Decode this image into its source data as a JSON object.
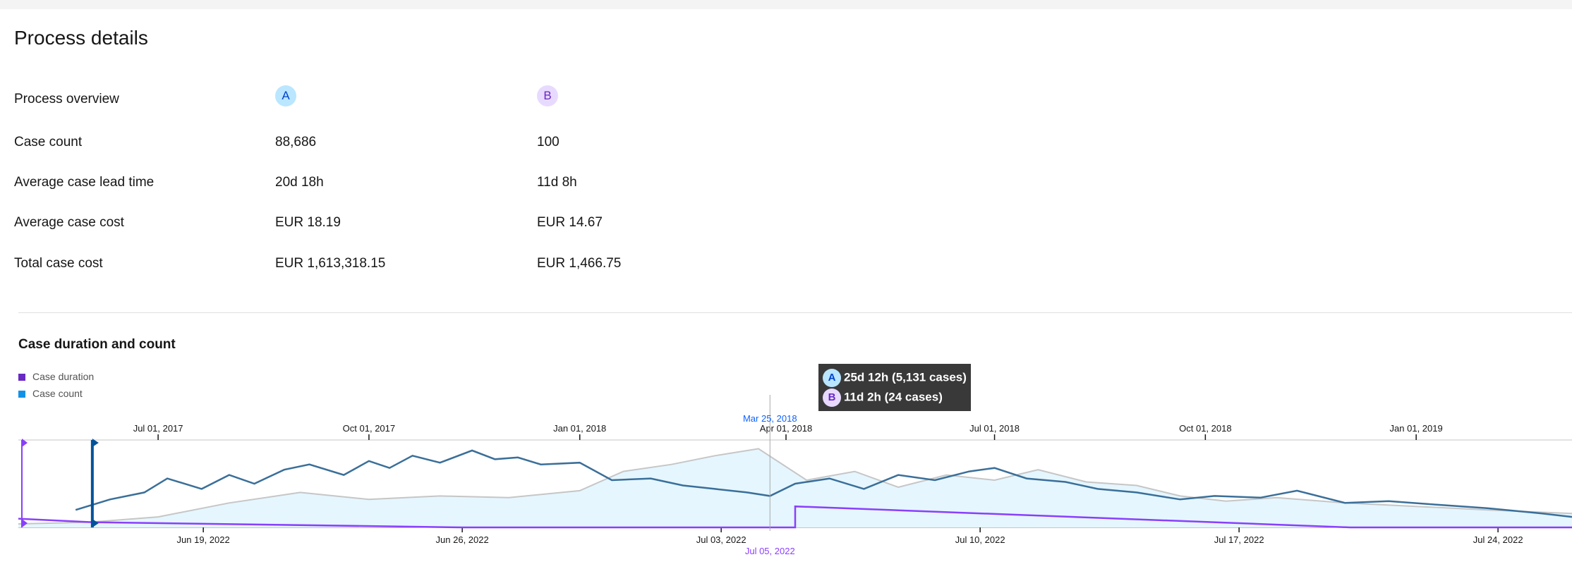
{
  "page_title": "Process details",
  "details": {
    "rows": [
      {
        "label": "Process overview",
        "a": "",
        "b": ""
      },
      {
        "label": "Case count",
        "a": "88,686",
        "b": "100"
      },
      {
        "label": "Average case lead time",
        "a": "20d 18h",
        "b": "11d 8h"
      },
      {
        "label": "Average case cost",
        "a": "EUR 18.19",
        "b": "EUR 14.67"
      },
      {
        "label": "Total case cost",
        "a": "EUR 1,613,318.15",
        "b": "EUR 1,466.75"
      }
    ],
    "badge_a": "A",
    "badge_b": "B"
  },
  "colors": {
    "badge_a_bg": "#bae6ff",
    "badge_b_bg": "#e8daff",
    "series_a_line": "#3a6f99",
    "series_a_fill": "#e5f6ff",
    "series_b_line": "#8a3ffc",
    "case_duration": "#6929c4",
    "case_count": "#1192e8",
    "tooltip_bg": "#393939"
  },
  "tooltip": {
    "a_badge": "A",
    "a_text": "25d 12h (5,131 cases)",
    "b_badge": "B",
    "b_text": "11d 2h (24 cases)"
  },
  "chart_data": {
    "type": "line",
    "title": "Case duration and count",
    "legend": [
      "Case duration",
      "Case count"
    ],
    "legend_position": "top-left",
    "cursor": {
      "top_label": "Mar 25, 2018",
      "bottom_label": "Jul 05, 2022"
    },
    "top_axis": {
      "ticks": [
        "Jul 01, 2017",
        "Oct 01, 2017",
        "Jan 01, 2018",
        "Apr 01, 2018",
        "Jul 01, 2018",
        "Oct 01, 2018",
        "Jan 01, 2019"
      ],
      "range": [
        "May 01, 2017",
        "Mar 10, 2019"
      ]
    },
    "bottom_axis": {
      "ticks": [
        "Jun 19, 2022",
        "Jun 26, 2022",
        "Jul 03, 2022",
        "Jul 10, 2022",
        "Jul 17, 2022",
        "Jul 24, 2022"
      ],
      "range": [
        "Jun 14, 2022",
        "Jul 26, 2022"
      ]
    },
    "series": [
      {
        "name": "A",
        "axis": "top",
        "dates": [
          "2017-05-26",
          "2017-06-10",
          "2017-06-25",
          "2017-07-05",
          "2017-07-20",
          "2017-08-01",
          "2017-08-12",
          "2017-08-25",
          "2017-09-05",
          "2017-09-20",
          "2017-10-01",
          "2017-10-10",
          "2017-10-20",
          "2017-11-01",
          "2017-11-15",
          "2017-11-25",
          "2017-12-05",
          "2017-12-15",
          "2018-01-01",
          "2018-01-15",
          "2018-02-01",
          "2018-02-15",
          "2018-03-01",
          "2018-03-15",
          "2018-03-25",
          "2018-04-05",
          "2018-04-20",
          "2018-05-05",
          "2018-05-20",
          "2018-06-05",
          "2018-06-20",
          "2018-07-01",
          "2018-07-15",
          "2018-08-01",
          "2018-08-15",
          "2018-09-01",
          "2018-09-20",
          "2018-10-05",
          "2018-10-25",
          "2018-11-10",
          "2018-12-01",
          "2018-12-20",
          "2019-01-10",
          "2019-02-01",
          "2019-02-25",
          "2019-03-10"
        ],
        "values": [
          10,
          16,
          20,
          28,
          22,
          30,
          25,
          33,
          36,
          30,
          38,
          34,
          41,
          37,
          44,
          39,
          40,
          36,
          37,
          27,
          28,
          24,
          22,
          20,
          18,
          25,
          28,
          22,
          30,
          27,
          32,
          34,
          28,
          26,
          22,
          20,
          16,
          18,
          17,
          21,
          14,
          15,
          13,
          11,
          8,
          6
        ]
      },
      {
        "name": "B",
        "axis": "top",
        "dates": [
          "2017-05-01",
          "2017-06-01",
          "2017-07-01",
          "2017-08-01",
          "2017-09-01",
          "2017-10-01",
          "2017-11-01",
          "2017-12-01",
          "2018-01-01",
          "2018-01-20",
          "2018-02-10",
          "2018-03-01",
          "2018-03-20",
          "2018-04-10",
          "2018-05-01",
          "2018-05-20",
          "2018-06-10",
          "2018-07-01",
          "2018-07-20",
          "2018-08-10",
          "2018-09-01",
          "2018-09-20",
          "2018-10-10",
          "2018-11-01",
          "2018-12-01",
          "2019-01-01",
          "2019-02-01",
          "2019-03-10"
        ],
        "values": [
          2,
          3,
          6,
          14,
          20,
          16,
          18,
          17,
          21,
          32,
          36,
          41,
          45,
          27,
          32,
          23,
          30,
          27,
          33,
          26,
          24,
          18,
          15,
          17,
          14,
          12,
          10,
          8
        ]
      },
      {
        "name": "Case duration",
        "axis": "bottom",
        "dates": [
          "2022-06-14",
          "2022-06-16",
          "2022-06-26",
          "2022-07-05",
          "2022-07-05",
          "2022-07-20",
          "2022-07-26"
        ],
        "values": [
          5,
          3,
          0,
          0,
          12,
          0,
          0
        ]
      }
    ],
    "ylim": [
      0,
      50
    ]
  }
}
